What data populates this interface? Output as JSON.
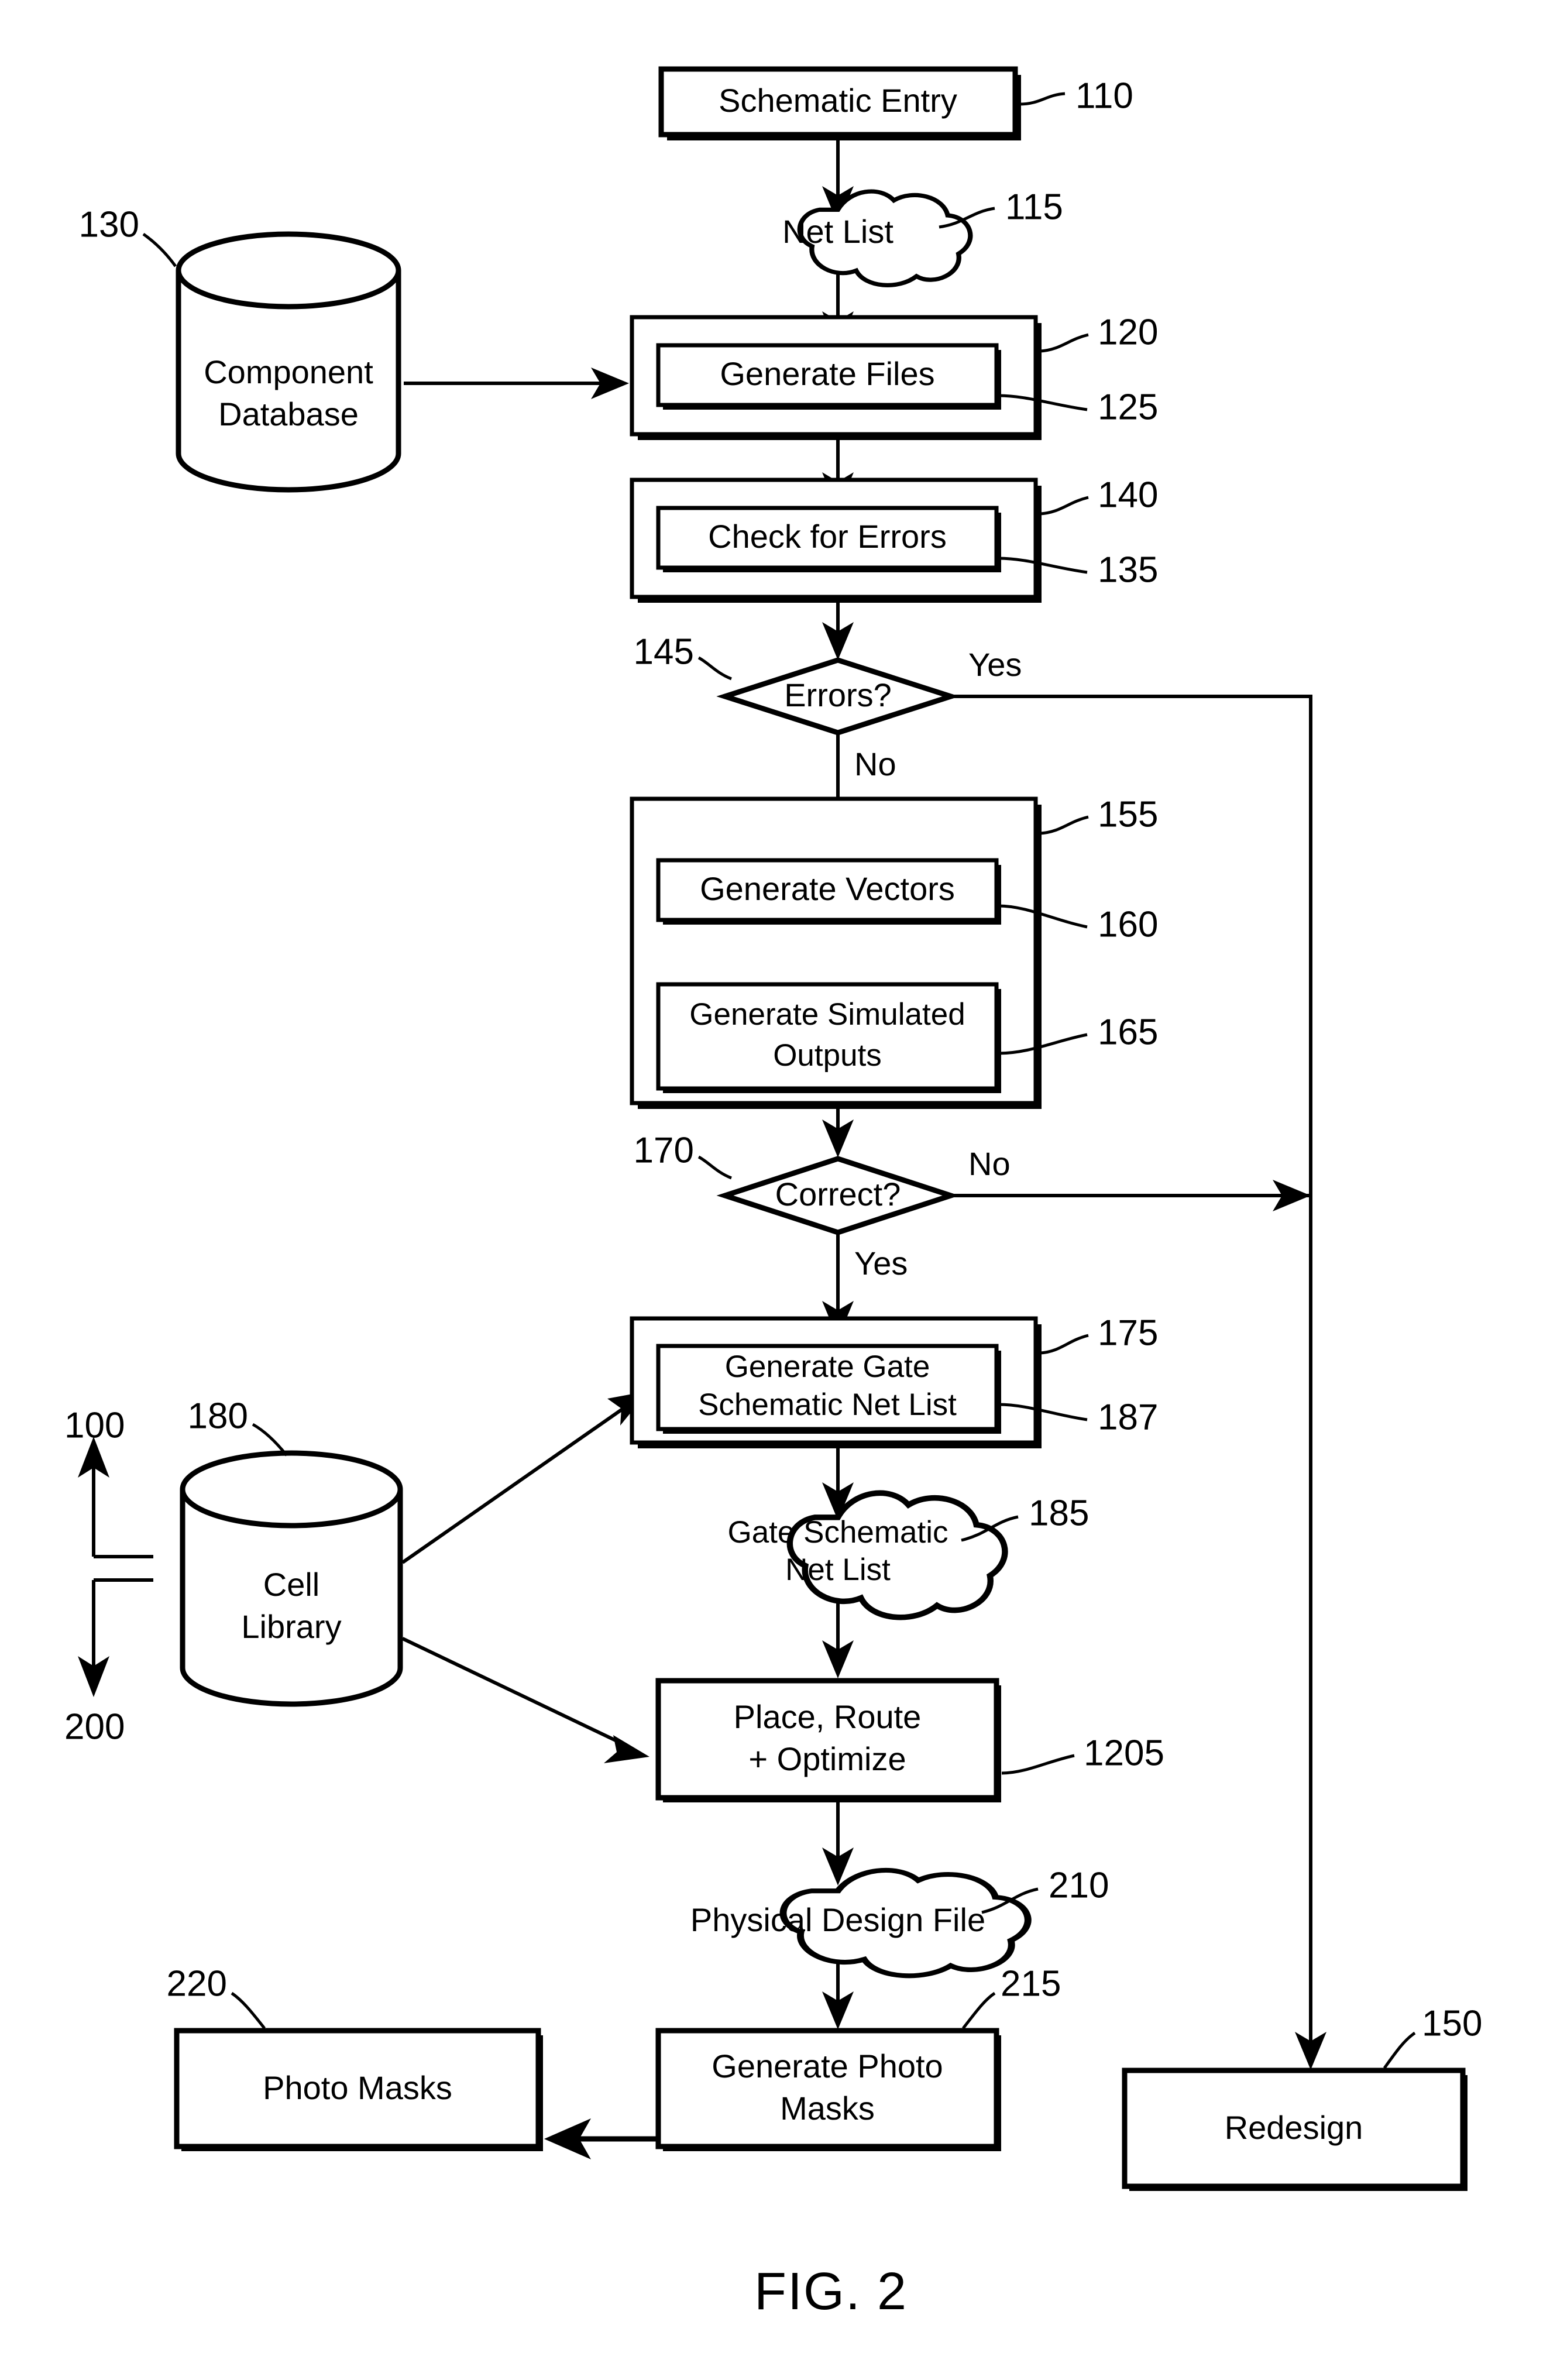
{
  "figure": {
    "caption": "FIG. 2",
    "scope_markers": {
      "upper": "100",
      "lower": "200"
    }
  },
  "nodes": {
    "schematic_entry": {
      "label": "Schematic Entry",
      "ref": "110",
      "shape": "process"
    },
    "net_list": {
      "label": "Net List",
      "ref": "115",
      "shape": "cloud"
    },
    "component_database": {
      "label_line1": "Component",
      "label_line2": "Database",
      "ref": "130",
      "shape": "cylinder"
    },
    "generate_files_outer": {
      "ref": "120",
      "shape": "container"
    },
    "generate_files": {
      "label": "Generate Files",
      "ref": "125",
      "shape": "process"
    },
    "check_errors_outer": {
      "ref": "140",
      "shape": "container"
    },
    "check_errors": {
      "label": "Check for Errors",
      "ref": "135",
      "shape": "process"
    },
    "errors_decision": {
      "label": "Errors?",
      "ref": "145",
      "shape": "decision"
    },
    "simulate_outer": {
      "ref": "155",
      "shape": "container"
    },
    "generate_vectors": {
      "label": "Generate Vectors",
      "ref": "160",
      "shape": "process"
    },
    "generate_simulated": {
      "label_line1": "Generate Simulated",
      "label_line2": "Outputs",
      "ref": "165",
      "shape": "process"
    },
    "correct_decision": {
      "label": "Correct?",
      "ref": "170",
      "shape": "decision"
    },
    "gate_netlist_outer": {
      "ref": "175",
      "shape": "container"
    },
    "generate_gate_netlist": {
      "label_line1": "Generate Gate",
      "label_line2": "Schematic Net List",
      "ref": "187",
      "shape": "process"
    },
    "gate_schematic_cloud": {
      "label_line1": "Gate Schematic",
      "label_line2": "Net List",
      "ref": "185",
      "shape": "cloud"
    },
    "cell_library": {
      "label_line1": "Cell",
      "label_line2": "Library",
      "ref": "180",
      "shape": "cylinder"
    },
    "place_route": {
      "label_line1": "Place, Route",
      "label_line2": "+ Optimize",
      "ref": "1205",
      "shape": "process"
    },
    "physical_design_file": {
      "label": "Physical Design File",
      "ref": "210",
      "shape": "cloud"
    },
    "generate_photo_masks": {
      "label_line1": "Generate Photo",
      "label_line2": "Masks",
      "ref": "215",
      "shape": "process"
    },
    "photo_masks": {
      "label": "Photo Masks",
      "ref": "220",
      "shape": "process"
    },
    "redesign": {
      "label": "Redesign",
      "ref": "150",
      "shape": "process"
    }
  },
  "branches": {
    "errors_yes": "Yes",
    "errors_no": "No",
    "correct_no": "No",
    "correct_yes": "Yes"
  },
  "colors": {
    "ink": "#000000",
    "paper": "#ffffff"
  }
}
